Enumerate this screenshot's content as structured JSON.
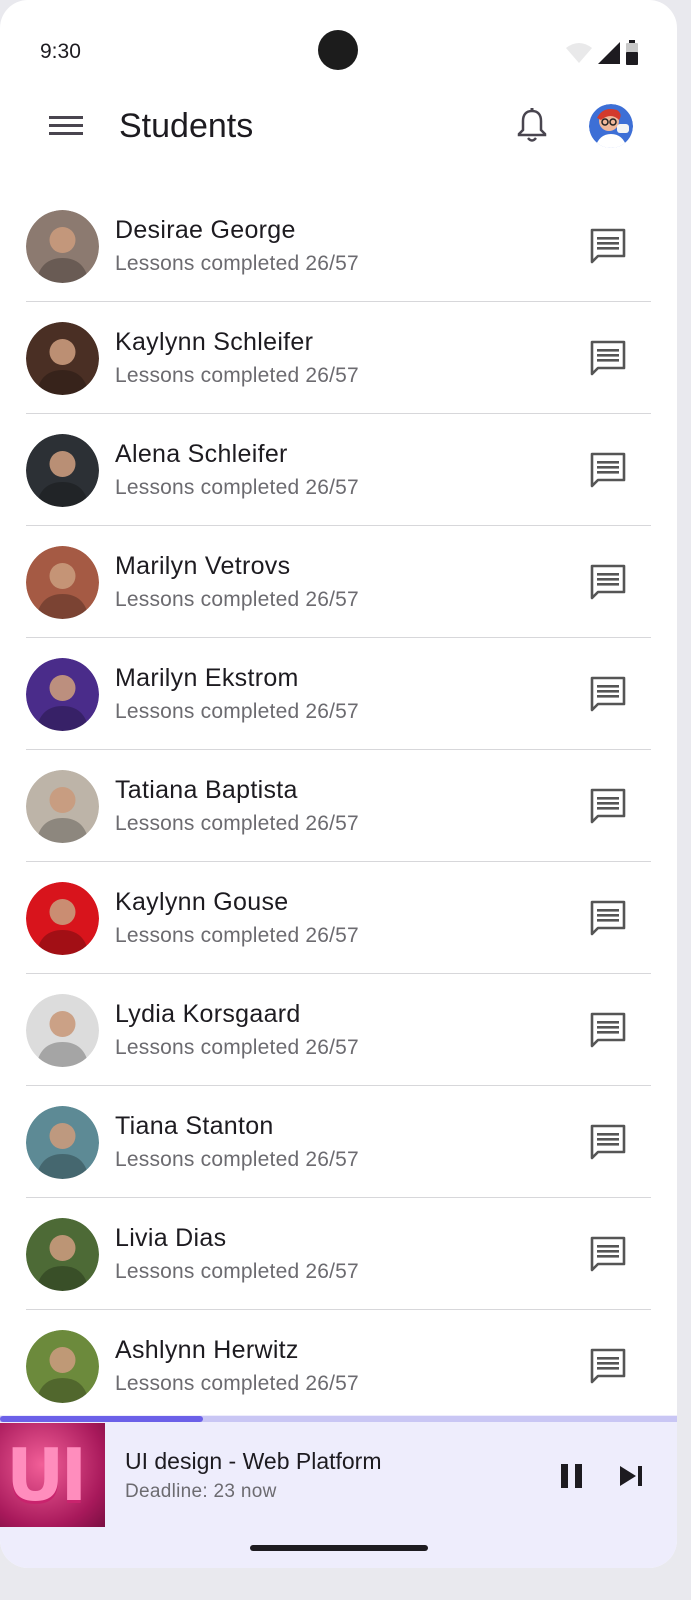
{
  "status_bar": {
    "time": "9:30"
  },
  "app_bar": {
    "title": "Students"
  },
  "students": [
    {
      "name": "Desirae George",
      "progress": "Lessons completed 26/57",
      "avatar_color": "#8c7a70"
    },
    {
      "name": "Kaylynn Schleifer",
      "progress": "Lessons completed 26/57",
      "avatar_color": "#4a2f24"
    },
    {
      "name": "Alena Schleifer",
      "progress": "Lessons completed 26/57",
      "avatar_color": "#2c3035"
    },
    {
      "name": "Marilyn Vetrovs",
      "progress": "Lessons completed 26/57",
      "avatar_color": "#a55a44"
    },
    {
      "name": "Marilyn Ekstrom",
      "progress": "Lessons completed 26/57",
      "avatar_color": "#4a2c8a"
    },
    {
      "name": "Tatiana Baptista",
      "progress": "Lessons completed 26/57",
      "avatar_color": "#bdb4a8"
    },
    {
      "name": "Kaylynn Gouse",
      "progress": "Lessons completed 26/57",
      "avatar_color": "#d8141c"
    },
    {
      "name": "Lydia Korsgaard",
      "progress": "Lessons completed 26/57",
      "avatar_color": "#dcdcdc"
    },
    {
      "name": "Tiana Stanton",
      "progress": "Lessons completed 26/57",
      "avatar_color": "#5d8a95"
    },
    {
      "name": "Livia Dias",
      "progress": "Lessons completed 26/57",
      "avatar_color": "#4d6a36"
    },
    {
      "name": "Ashlynn Herwitz",
      "progress": "Lessons completed 26/57",
      "avatar_color": "#6c8a3c"
    }
  ],
  "mini_player": {
    "thumb_text": "UI",
    "title": "UI design - Web Platform",
    "deadline": "Deadline: 23 now",
    "progress_fraction": 0.3
  },
  "colors": {
    "accent": "#6b60e8",
    "player_bg": "#eeedfc"
  }
}
